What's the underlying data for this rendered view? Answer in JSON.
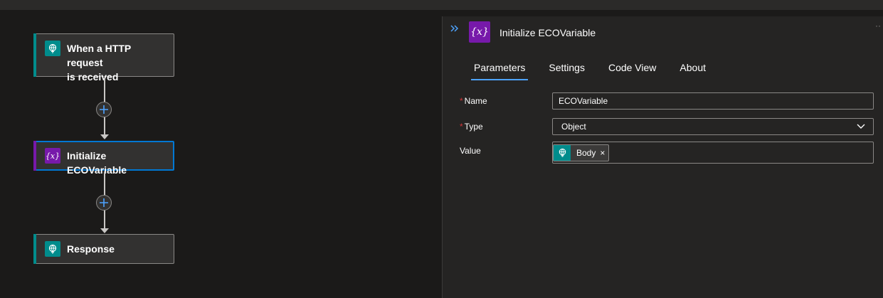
{
  "flow": {
    "trigger": {
      "title_line1": "When a HTTP request",
      "title_line2": "is received",
      "accent": "#008c8c"
    },
    "action1": {
      "title": "Initialize ECOVariable",
      "accent": "#7719aa"
    },
    "action2": {
      "title": "Response",
      "accent": "#008c8c"
    }
  },
  "panel": {
    "title": "Initialize ECOVariable",
    "tabs": [
      {
        "label": "Parameters",
        "active": true
      },
      {
        "label": "Settings"
      },
      {
        "label": "Code View"
      },
      {
        "label": "About"
      }
    ],
    "fields": {
      "name": {
        "label": "Name",
        "required_mark": "*",
        "value": "ECOVariable"
      },
      "type": {
        "label": "Type",
        "required_mark": "*",
        "value": "Object"
      },
      "value": {
        "label": "Value",
        "token": {
          "label": "Body",
          "close": "×"
        }
      }
    }
  },
  "icons": {
    "trigger": "http-request-icon",
    "variable": "variable-icon",
    "response": "http-response-icon",
    "add": "plus-icon",
    "collapse": "double-chevron-right-icon",
    "dropdown": "chevron-down-icon"
  },
  "colors": {
    "accent": "#4da3ff",
    "selected_border": "#0078d4",
    "required": "#d13438"
  }
}
